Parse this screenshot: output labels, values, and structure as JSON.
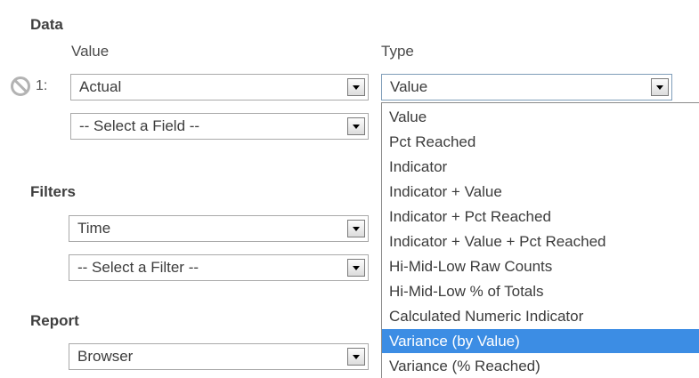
{
  "data_section": {
    "title": "Data",
    "value_column_label": "Value",
    "type_column_label": "Type",
    "row_number": "1:",
    "value_selected": "Actual",
    "field_placeholder": "-- Select a Field --",
    "type_selected": "Value"
  },
  "filters_section": {
    "title": "Filters",
    "filter_selected": "Time",
    "filter_placeholder": "-- Select a Filter --"
  },
  "report_section": {
    "title": "Report",
    "report_selected": "Browser"
  },
  "type_dropdown": {
    "options": [
      "Value",
      "Pct Reached",
      "Indicator",
      "Indicator + Value",
      "Indicator + Pct Reached",
      "Indicator + Value + Pct Reached",
      "Hi-Mid-Low Raw Counts",
      "Hi-Mid-Low % of Totals",
      "Calculated Numeric Indicator",
      "Variance (by Value)",
      "Variance (% Reached)"
    ],
    "highlighted_index": 9
  },
  "icons": {
    "remove_row": "ban-icon",
    "select_arrow": "chevron-down-icon"
  },
  "colors": {
    "highlight": "#3c8de4",
    "border": "#a9a9a9"
  }
}
